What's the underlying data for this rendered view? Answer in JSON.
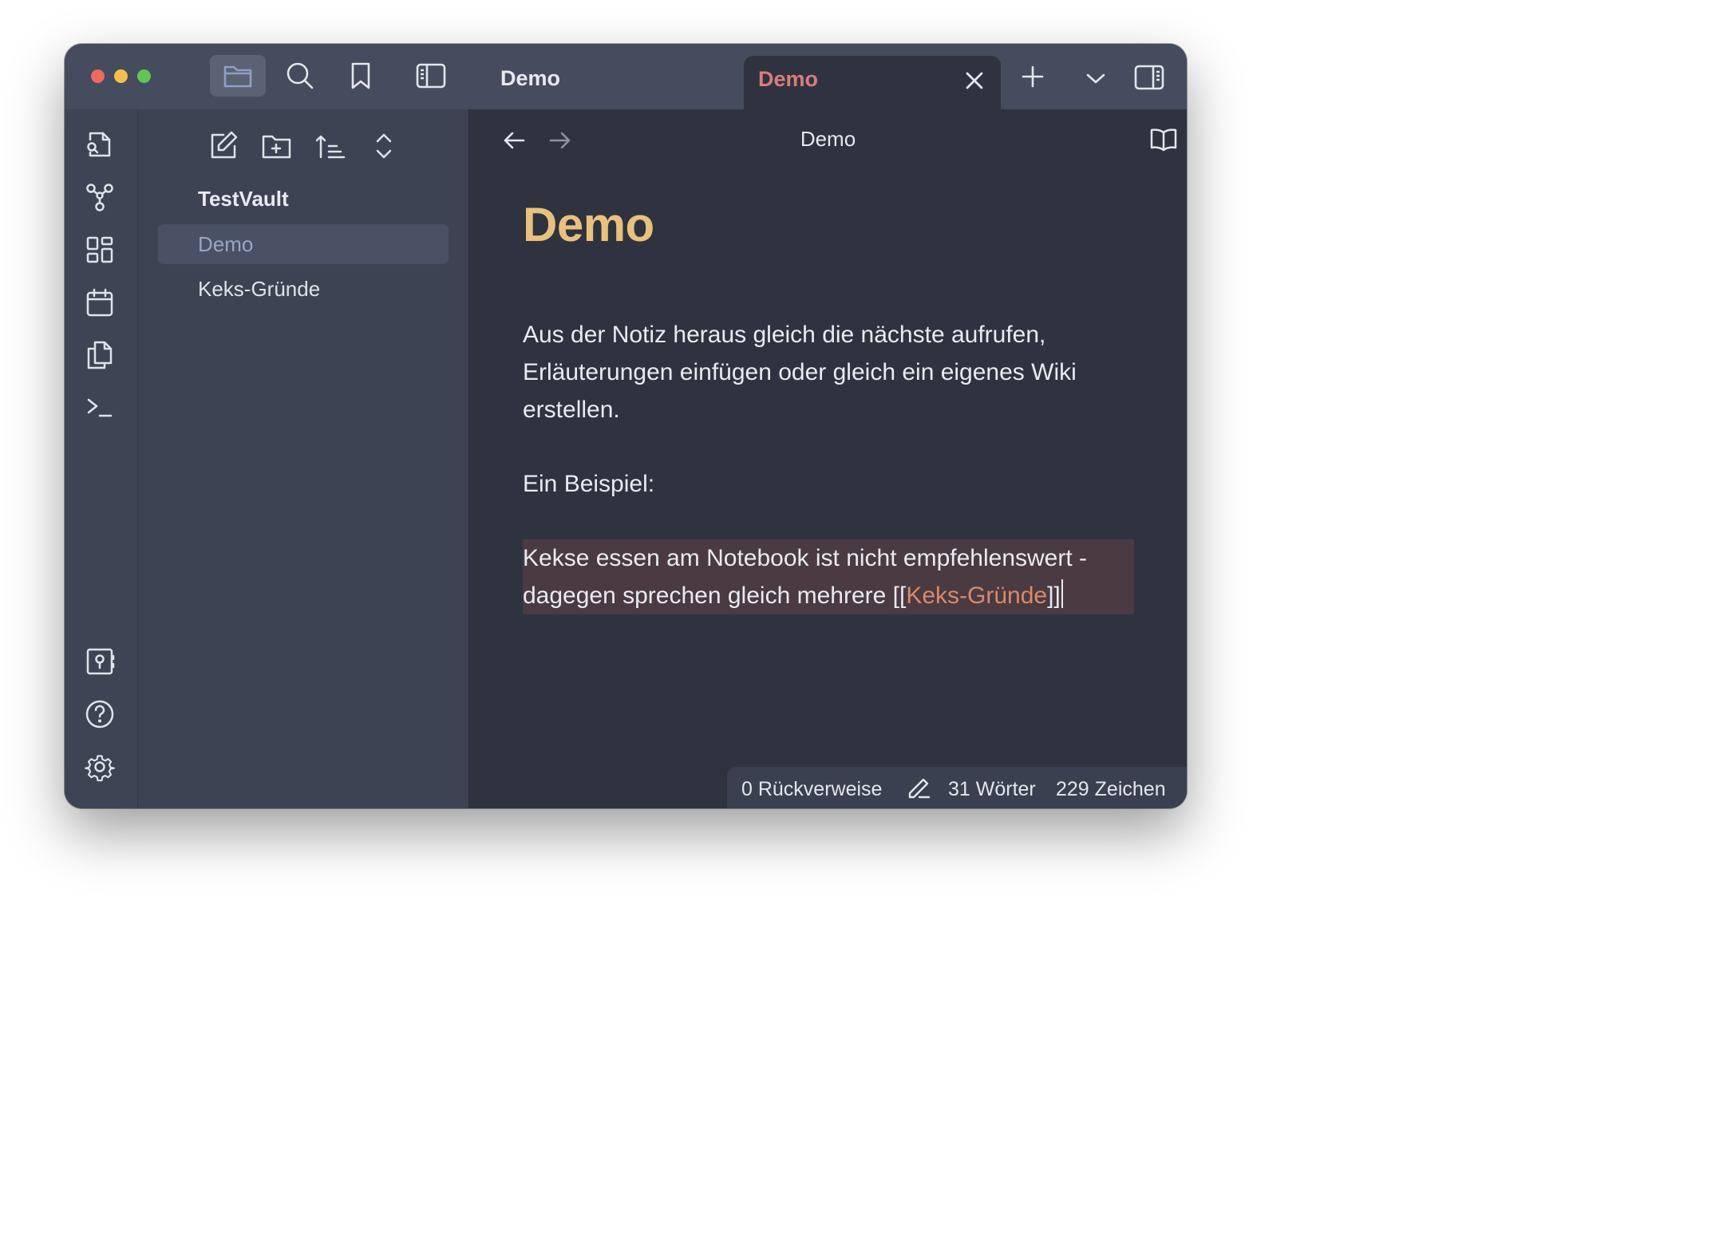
{
  "window": {
    "tab_bar": {
      "left_pane_title": "Demo",
      "active_tab": {
        "label": "Demo",
        "color": "#d97d7b"
      }
    },
    "sidebar_header": {
      "icons": [
        "folder-icon",
        "search-icon",
        "bookmark-icon",
        "sidebar-toggle-icon"
      ]
    },
    "ribbon": {
      "top_icons": [
        "quick-switcher-icon",
        "graph-view-icon",
        "canvas-icon",
        "daily-note-icon",
        "templates-icon",
        "command-palette-icon"
      ],
      "bottom_icons": [
        "vault-switch-icon",
        "help-icon",
        "settings-icon"
      ]
    },
    "file_explorer": {
      "tools": [
        "new-note-icon",
        "new-folder-icon",
        "sort-icon",
        "collapse-icon"
      ],
      "vault_name": "TestVault",
      "files": [
        {
          "label": "Demo",
          "selected": true
        },
        {
          "label": "Keks-Gründe",
          "selected": false
        }
      ]
    },
    "editor": {
      "header_title": "Demo",
      "note": {
        "heading": "Demo",
        "paragraph1": "Aus der Notiz heraus gleich die nächste aufrufen, Erläuterungen einfügen oder gleich ein eigenes Wiki erstellen.",
        "paragraph2": "Ein Beispiel:",
        "paragraph3_prefix": "Kekse essen am Notebook ist nicht empfehlenswert - dagegen sprechen  gleich mehrere ",
        "link_open": "[[",
        "link_text": "Keks-Gründe",
        "link_close": "]]"
      }
    },
    "status_bar": {
      "backlinks": "0 Rückverweise",
      "words": "31 Wörter",
      "characters": "229 Zeichen"
    },
    "colors": {
      "heading": "#e8c17e",
      "link": "#d98a67",
      "selection": "#4a3a42",
      "accent_tab": "#d97d7b"
    }
  }
}
